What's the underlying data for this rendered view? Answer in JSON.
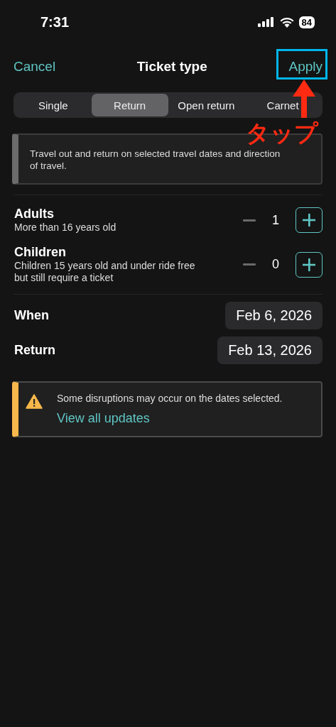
{
  "status_bar": {
    "time": "7:31",
    "battery": "84"
  },
  "header": {
    "cancel": "Cancel",
    "title": "Ticket type",
    "apply": "Apply"
  },
  "tabs": [
    {
      "label": "Single",
      "selected": false
    },
    {
      "label": "Return",
      "selected": true
    },
    {
      "label": "Open return",
      "selected": false
    },
    {
      "label": "Carnet",
      "selected": false
    }
  ],
  "description": "Travel out and return on selected travel dates and direction of travel.",
  "passengers": [
    {
      "name": "Adults",
      "note": "More than 16 years old",
      "count": "1"
    },
    {
      "name": "Children",
      "note": "Children 15 years old and under ride free but still require a ticket",
      "count": "0"
    }
  ],
  "dates": [
    {
      "label": "When",
      "value": "Feb 6, 2026"
    },
    {
      "label": "Return",
      "value": "Feb 13, 2026"
    }
  ],
  "warning": {
    "text": "Some disruptions may occur on the dates selected.",
    "link": "View all updates"
  },
  "annotation": {
    "text": "タップ"
  }
}
